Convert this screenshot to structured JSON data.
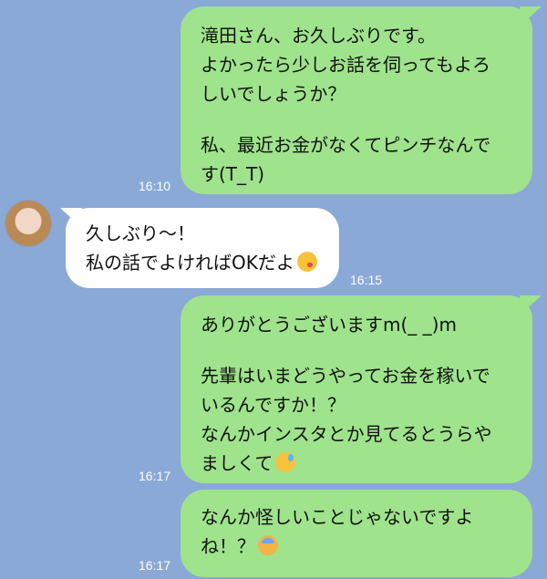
{
  "messages": [
    {
      "side": "out",
      "lines": [
        "滝田さん、お久しぶりです。",
        "よかったら少しお話を伺ってもよろ",
        "しいでしょうか？",
        "",
        "私、最近お金がなくてピンチなんで",
        "す(T_T)"
      ],
      "time": "16:10"
    },
    {
      "side": "in",
      "lines": [
        "久しぶり～！",
        "私の話でよければOKだよ"
      ],
      "emoji": "kissing-face-icon",
      "time": "16:15"
    },
    {
      "side": "out",
      "lines": [
        "ありがとうございますm(_ _)m",
        "",
        "先輩はいまどうやってお金を稼いで",
        "いるんですか！？",
        "なんかインスタとか見てるとうらや",
        "ましくて"
      ],
      "emoji": "grinning-sweat-face-icon",
      "time": "16:17"
    },
    {
      "side": "out",
      "lines": [
        "なんか怪しいことじゃないですよ",
        "ね！？"
      ],
      "emoji": "sad-sweat-face-icon",
      "time": "16:17"
    }
  ],
  "colors": {
    "background": "#8aa9d6",
    "outgoing_bubble": "#9fe38c",
    "incoming_bubble": "#ffffff"
  }
}
